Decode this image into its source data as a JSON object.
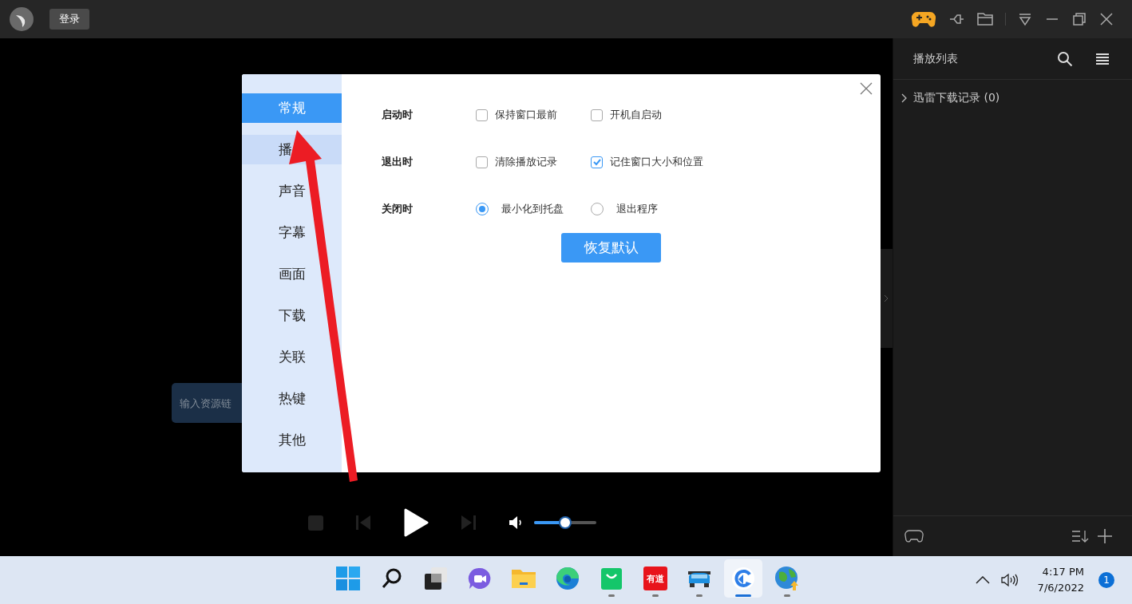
{
  "title_bar": {
    "login_button": "登录"
  },
  "playlist": {
    "title": "播放列表",
    "items": [
      {
        "label": "迅雷下载记录 (0)",
        "expanded": false
      }
    ]
  },
  "link_field": {
    "placeholder": "输入资源链"
  },
  "player": {
    "volume": {
      "level": 0.5
    }
  },
  "settings_dialog": {
    "nav": [
      {
        "label": "常规",
        "selected": true,
        "hovered": false
      },
      {
        "label": "播",
        "selected": false,
        "hovered": true
      },
      {
        "label": "声音",
        "selected": false,
        "hovered": false
      },
      {
        "label": "字幕",
        "selected": false,
        "hovered": false
      },
      {
        "label": "画面",
        "selected": false,
        "hovered": false
      },
      {
        "label": "下载",
        "selected": false,
        "hovered": false
      },
      {
        "label": "关联",
        "selected": false,
        "hovered": false
      },
      {
        "label": "热键",
        "selected": false,
        "hovered": false
      },
      {
        "label": "其他",
        "selected": false,
        "hovered": false
      }
    ],
    "sections": [
      {
        "label": "启动时",
        "options": [
          {
            "kind": "checkbox",
            "label": "保持窗口最前",
            "checked": false
          },
          {
            "kind": "checkbox",
            "label": "开机自启动",
            "checked": false
          }
        ]
      },
      {
        "label": "退出时",
        "options": [
          {
            "kind": "checkbox",
            "label": "清除播放记录",
            "checked": false
          },
          {
            "kind": "checkbox",
            "label": "记住窗口大小和位置",
            "checked": true
          }
        ]
      },
      {
        "label": "关闭时",
        "options": [
          {
            "kind": "radio",
            "label": "最小化到托盘",
            "checked": true
          },
          {
            "kind": "radio",
            "label": "退出程序",
            "checked": false
          }
        ]
      }
    ],
    "reset_button": "恢复默认"
  },
  "taskbar": {
    "apps": [
      {
        "kind": "start",
        "running": false,
        "active": false
      },
      {
        "kind": "search",
        "running": false,
        "active": false
      },
      {
        "kind": "task-view",
        "running": false,
        "active": false
      },
      {
        "kind": "chat",
        "running": false,
        "active": false
      },
      {
        "kind": "folder",
        "running": false,
        "active": false
      },
      {
        "kind": "browser",
        "running": false,
        "active": false
      },
      {
        "kind": "store",
        "running": true,
        "active": false
      },
      {
        "kind": "dictionary",
        "label": "有道",
        "running": true,
        "active": false
      },
      {
        "kind": "car",
        "running": true,
        "active": false
      },
      {
        "kind": "player",
        "running": true,
        "active": true
      },
      {
        "kind": "globe",
        "running": true,
        "active": false
      }
    ],
    "time": "4:17 PM",
    "date": "7/6/2022",
    "notifications": "1"
  }
}
